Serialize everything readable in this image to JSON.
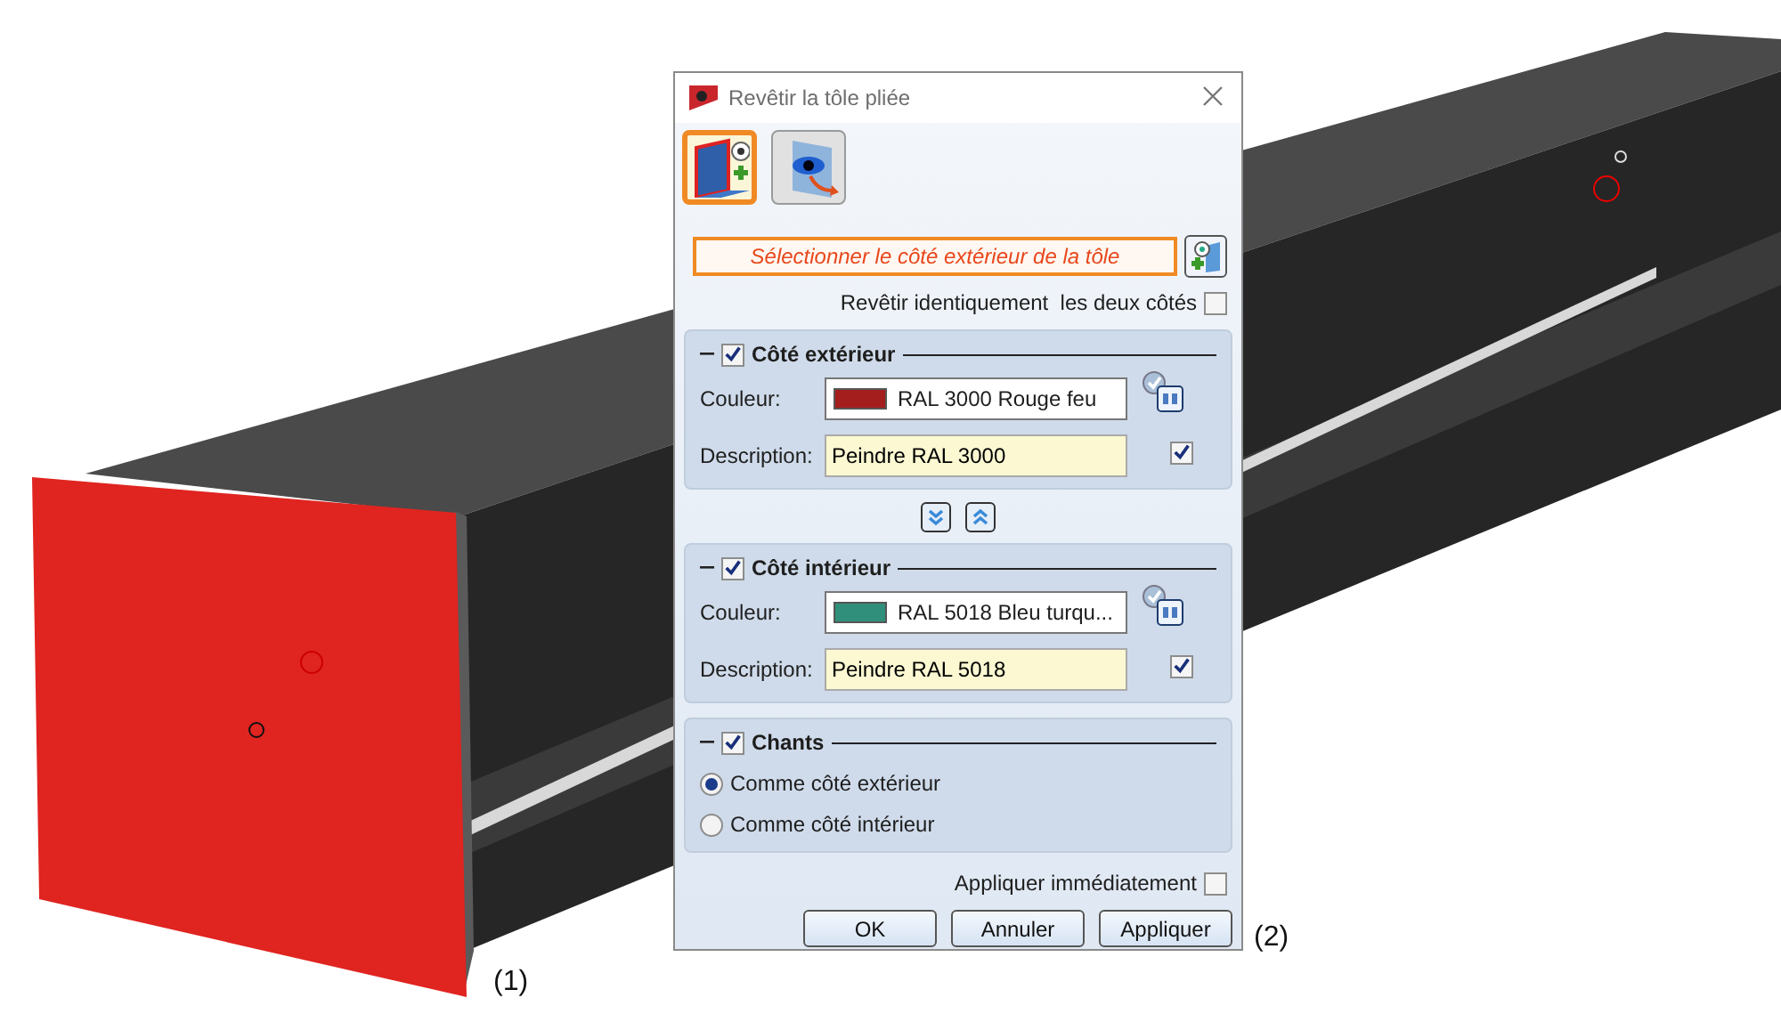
{
  "labels": [
    {
      "text": "(1)"
    },
    {
      "text": "(2)"
    }
  ],
  "dialog": {
    "title": "Revêtir la tôle pliée",
    "modes": [
      {
        "selected": true
      },
      {
        "selected": false
      }
    ],
    "prompt": "Sélectionner le côté extérieur de la tôle",
    "same_both_sides": {
      "label": "Revêtir identiquement  les deux côtés",
      "checked": false
    },
    "sides": [
      {
        "title": "Côté extérieur",
        "checked": true,
        "color_label": "Couleur:",
        "color_name": "RAL 3000 Rouge feu",
        "color": "#a51e1e",
        "description_label": "Description:",
        "description": "Peindre RAL 3000",
        "description_checked": true
      },
      {
        "title": "Côté intérieur",
        "checked": true,
        "color_label": "Couleur:",
        "color_name": "RAL 5018 Bleu turqu...",
        "color": "#2f8f7a",
        "description_label": "Description:",
        "description": "Peindre RAL 5018",
        "description_checked": true
      }
    ],
    "edges": {
      "title": "Chants",
      "checked": true,
      "options": [
        {
          "label": "Comme côté extérieur",
          "selected": true
        },
        {
          "label": "Comme côté intérieur",
          "selected": false
        }
      ]
    },
    "apply_immediately": {
      "label": "Appliquer immédiatement",
      "checked": false
    },
    "buttons": [
      "OK",
      "Annuler",
      "Appliquer"
    ]
  }
}
